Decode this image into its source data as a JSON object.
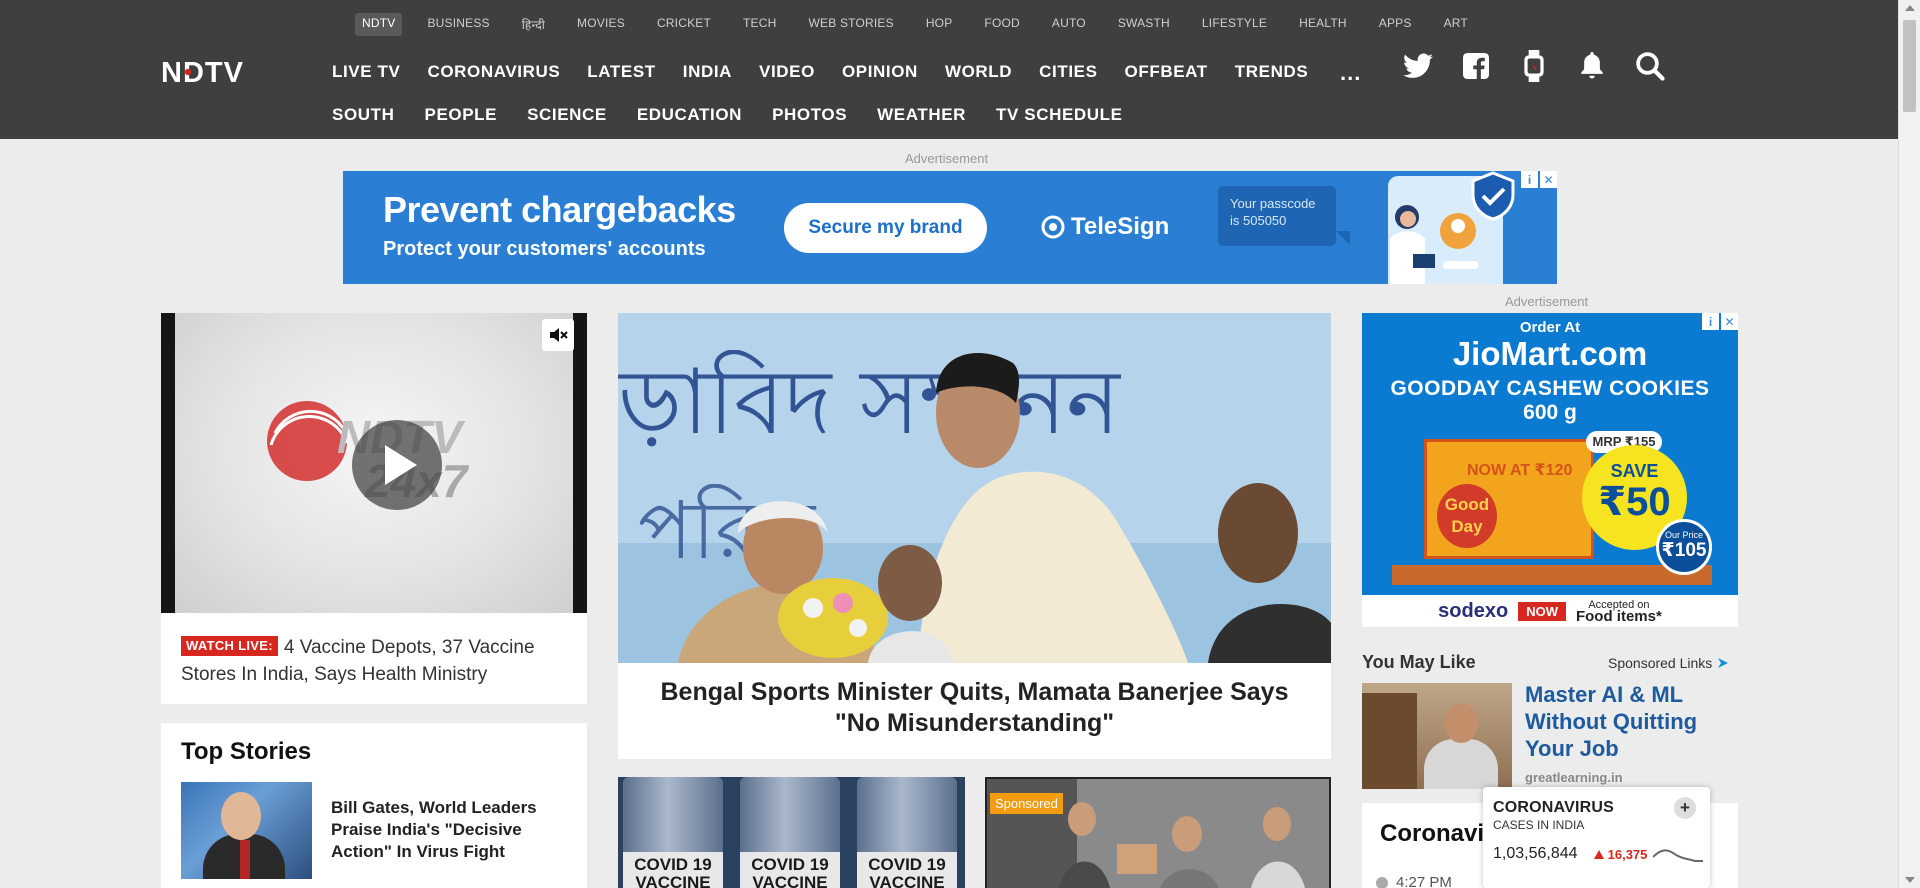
{
  "subnav": [
    "NDTV",
    "BUSINESS",
    "हिन्दी",
    "MOVIES",
    "CRICKET",
    "TECH",
    "WEB STORIES",
    "HOP",
    "FOOD",
    "AUTO",
    "SWASTH",
    "LIFESTYLE",
    "HEALTH",
    "APPS",
    "ART"
  ],
  "logo_text": "NDTV",
  "nav_row1": [
    "LIVE TV",
    "CORONAVIRUS",
    "LATEST",
    "INDIA",
    "VIDEO",
    "OPINION",
    "WORLD",
    "CITIES",
    "OFFBEAT",
    "TRENDS"
  ],
  "nav_more": "...",
  "nav_row2": [
    "SOUTH",
    "PEOPLE",
    "SCIENCE",
    "EDUCATION",
    "PHOTOS",
    "WEATHER",
    "TV SCHEDULE"
  ],
  "header_icons": [
    "twitter-icon",
    "facebook-icon",
    "smartwatch-icon",
    "notification-bell-icon",
    "search-icon"
  ],
  "ad_label": "Advertisement",
  "top_ad": {
    "headline": "Prevent chargebacks",
    "subline": "Protect your customers' accounts",
    "button": "Secure my brand",
    "brand": "TeleSign",
    "passcode_line1": "Your passcode",
    "passcode_line2": "is 505050",
    "info": "i",
    "close": "✕"
  },
  "video": {
    "live_badge": "WATCH LIVE:",
    "headline": "4 Vaccine Depots, 37 Vaccine Stores In India, Says Health Ministry"
  },
  "top_stories": {
    "title": "Top Stories",
    "items": [
      {
        "headline": "Bill Gates, World Leaders Praise India's \"Decisive Action\" In Virus Fight"
      }
    ]
  },
  "lead_story": {
    "headline": "Bengal Sports Minister Quits, Mamata Banerjee Says \"No Misunderstanding\""
  },
  "sub_stories": [
    {
      "vial_label": "COVID 19\nVACCINE"
    },
    {
      "tag": "Sponsored"
    }
  ],
  "side_ad": {
    "order_at": "Order At",
    "brand": "JioMart.com",
    "product_line1": "GOODDAY CASHEW COOKIES",
    "product_line2": "600 g",
    "now_at": "NOW AT ₹120",
    "pack_name": "Good Day",
    "mrp": "MRP ₹155",
    "save_label": "SAVE",
    "save_amount": "₹50",
    "our_price_label": "Our Price",
    "our_price": "₹105",
    "footer_brand": "sodexo",
    "footer_now": "NOW",
    "accepted_line1": "Accepted on",
    "accepted_line2": "Food items*"
  },
  "you_may_like": {
    "title": "You May Like",
    "sponsored": "Sponsored Links",
    "headline": "Master AI & ML Without Quitting Your Job",
    "source": "greatlearning.in"
  },
  "corona_card": {
    "title": "Coronavi",
    "time": "4:27 PM"
  },
  "corona_widget": {
    "title": "CORONAVIRUS",
    "subtitle": "CASES IN INDIA",
    "count": "1,03,56,844",
    "delta": "16,375",
    "expand": "+"
  },
  "colors": {
    "header_bg": "#3f3f3f",
    "page_bg": "#ececec",
    "accent_red": "#d6281f",
    "link_blue": "#1e5a9e"
  }
}
